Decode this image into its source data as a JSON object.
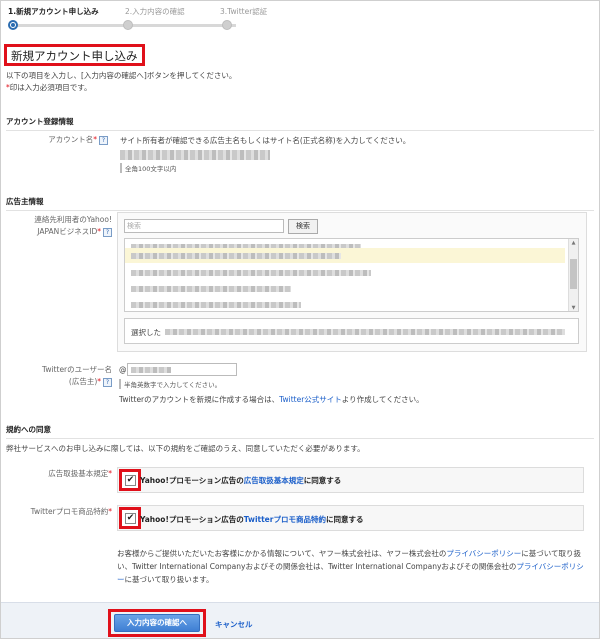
{
  "steps": [
    {
      "label": "1.新規アカウント申し込み",
      "state": "active"
    },
    {
      "label": "2.入力内容の確認",
      "state": "inactive"
    },
    {
      "label": "3.Twitter認証",
      "state": "inactive"
    }
  ],
  "page_title": "新規アカウント申し込み",
  "intro": {
    "line1": "以下の項目を入力し、[入力内容の確認へ]ボタンを押してください。",
    "line2": "印は入力必須項目です。",
    "required_mark": "*"
  },
  "account_section": {
    "heading": "アカウント登録情報",
    "account_name_label": "アカウント名",
    "account_name_desc": "サイト所有者が確認できる広告主名もしくはサイト名(正式名称)を入力してください。",
    "account_name_hint": "全角100文字以内"
  },
  "advertiser_section": {
    "heading": "広告主情報",
    "contact_label_line1": "連絡先利用者のYahoo!",
    "contact_label_line2": "JAPANビジネスID",
    "search_placeholder": "検索",
    "search_button": "検索",
    "selected_prefix": "選択した",
    "twitter_label_line1": "Twitterのユーザー名",
    "twitter_label_line2": "(広告主)",
    "twitter_prefix": "@",
    "twitter_hint": "半角英数字で入力してください。",
    "twitter_note_before": "Twitterのアカウントを新規に作成する場合は、",
    "twitter_note_link": "Twitter公式サイト",
    "twitter_note_after": "より作成してください。"
  },
  "terms_section": {
    "heading": "規約への同意",
    "intro": "弊社サービスへのお申し込みに際しては、以下の規約をご確認のうえ、同意していただく必要があります。",
    "ad_terms_label": "広告取扱基本規定",
    "ad_terms_text_before": "Yahoo!プロモーション広告の",
    "ad_terms_link": "広告取扱基本規定",
    "ad_terms_text_after": "に同意する",
    "twitter_terms_label": "Twitterプロモ商品特約",
    "twitter_terms_text_before": "Yahoo!プロモーション広告の",
    "twitter_terms_link": "Twitterプロモ商品特約",
    "twitter_terms_text_after": "に同意する",
    "check_mark": "✔",
    "notice_1": "お客様からご提供いただいたお客様にかかる情報について、ヤフー株式会社は、ヤフー株式会社の",
    "notice_link1": "プライバシーポリシー",
    "notice_2": "に基づいて取り扱い、Twitter International Companyおよびその関係会社は、Twitter International Companyおよびその関係会社の",
    "notice_link2": "プライバシーポリシー",
    "notice_3": "に基づいて取り扱います。"
  },
  "footer": {
    "submit_label": "入力内容の確認へ",
    "cancel_label": "キャンセル"
  },
  "colors": {
    "highlight": "#e0101a",
    "link": "#1a5ec9",
    "primary_button": "#3f7fd3"
  }
}
